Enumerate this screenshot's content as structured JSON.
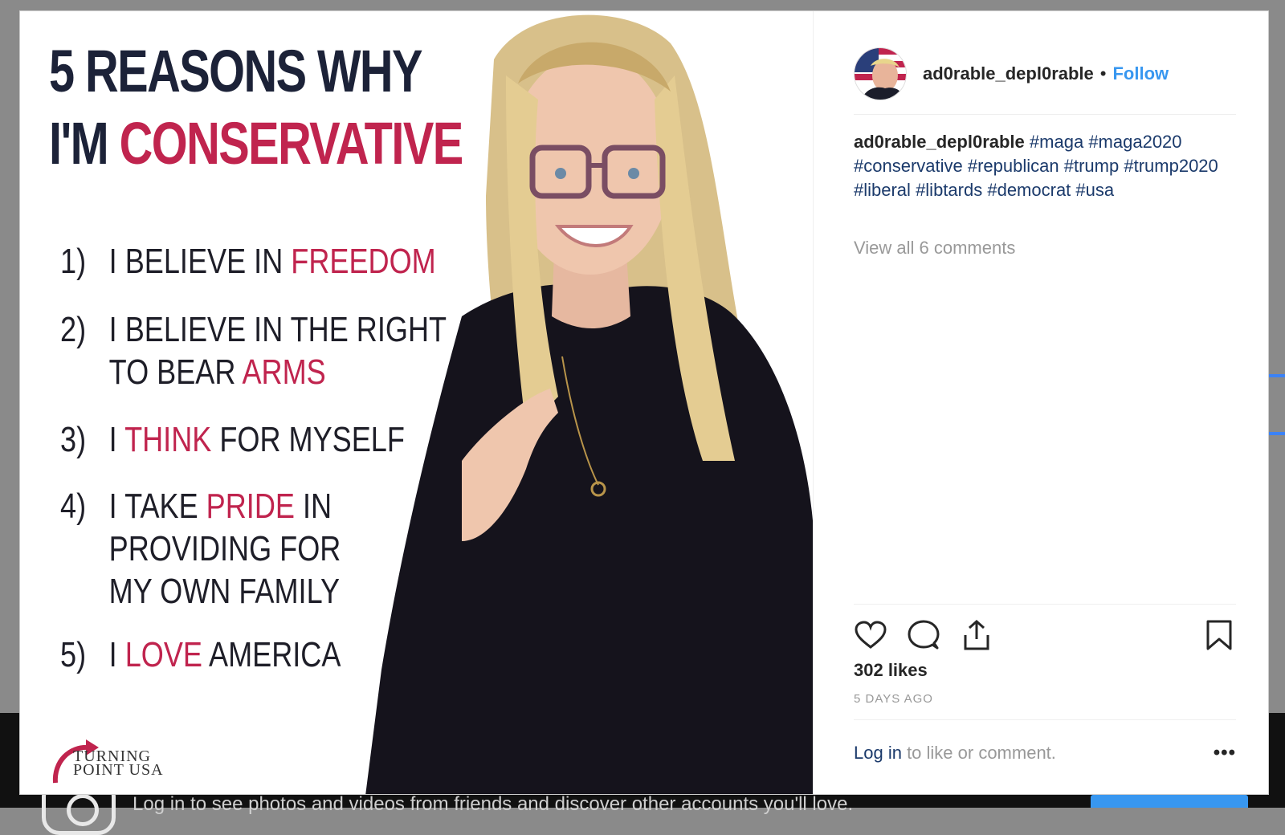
{
  "backdrop": {
    "footer_text": "Log in to see photos and videos from friends and discover other accounts you'll love."
  },
  "post_image": {
    "title_line1": "5 REASONS WHY",
    "title_line2_a": "I'M ",
    "title_line2_b": "CONSERVATIVE",
    "reasons": [
      {
        "num": "1)",
        "parts": [
          [
            "I BELIEVE IN ",
            "FREEDOM",
            ""
          ]
        ]
      },
      {
        "num": "2)",
        "parts": [
          [
            "I BELIEVE IN THE RIGHT",
            "",
            ""
          ],
          [
            "TO BEAR ",
            "ARMS",
            ""
          ]
        ]
      },
      {
        "num": "3)",
        "parts": [
          [
            "I ",
            "THINK",
            " FOR MYSELF"
          ]
        ]
      },
      {
        "num": "4)",
        "parts": [
          [
            "I TAKE ",
            "PRIDE",
            " IN"
          ],
          [
            "PROVIDING FOR",
            "",
            ""
          ],
          [
            "MY OWN FAMILY",
            "",
            ""
          ]
        ]
      },
      {
        "num": "5)",
        "parts": [
          [
            "I ",
            "LOVE",
            " AMERICA"
          ]
        ]
      }
    ],
    "logo_line1": "TURNING",
    "logo_line2": "POINT USA"
  },
  "header": {
    "username": "ad0rable_depl0rable",
    "separator": "•",
    "follow_label": "Follow"
  },
  "caption": {
    "username": "ad0rable_depl0rable",
    "hashtags": [
      "#maga",
      "#maga2020",
      "#conservative",
      "#republican",
      "#trump",
      "#trump2020",
      "#liberal",
      "#libtards",
      "#democrat",
      "#usa"
    ]
  },
  "view_comments": "View all 6 comments",
  "likes": "302 likes",
  "time": "5 DAYS AGO",
  "login_prompt": {
    "link": "Log in",
    "rest": " to like or comment."
  },
  "more_label": "•••",
  "colors": {
    "follow_blue": "#3897f0",
    "meme_red": "#c0244e",
    "meme_navy": "#1c2238",
    "hashtag": "#1b3a6b"
  }
}
